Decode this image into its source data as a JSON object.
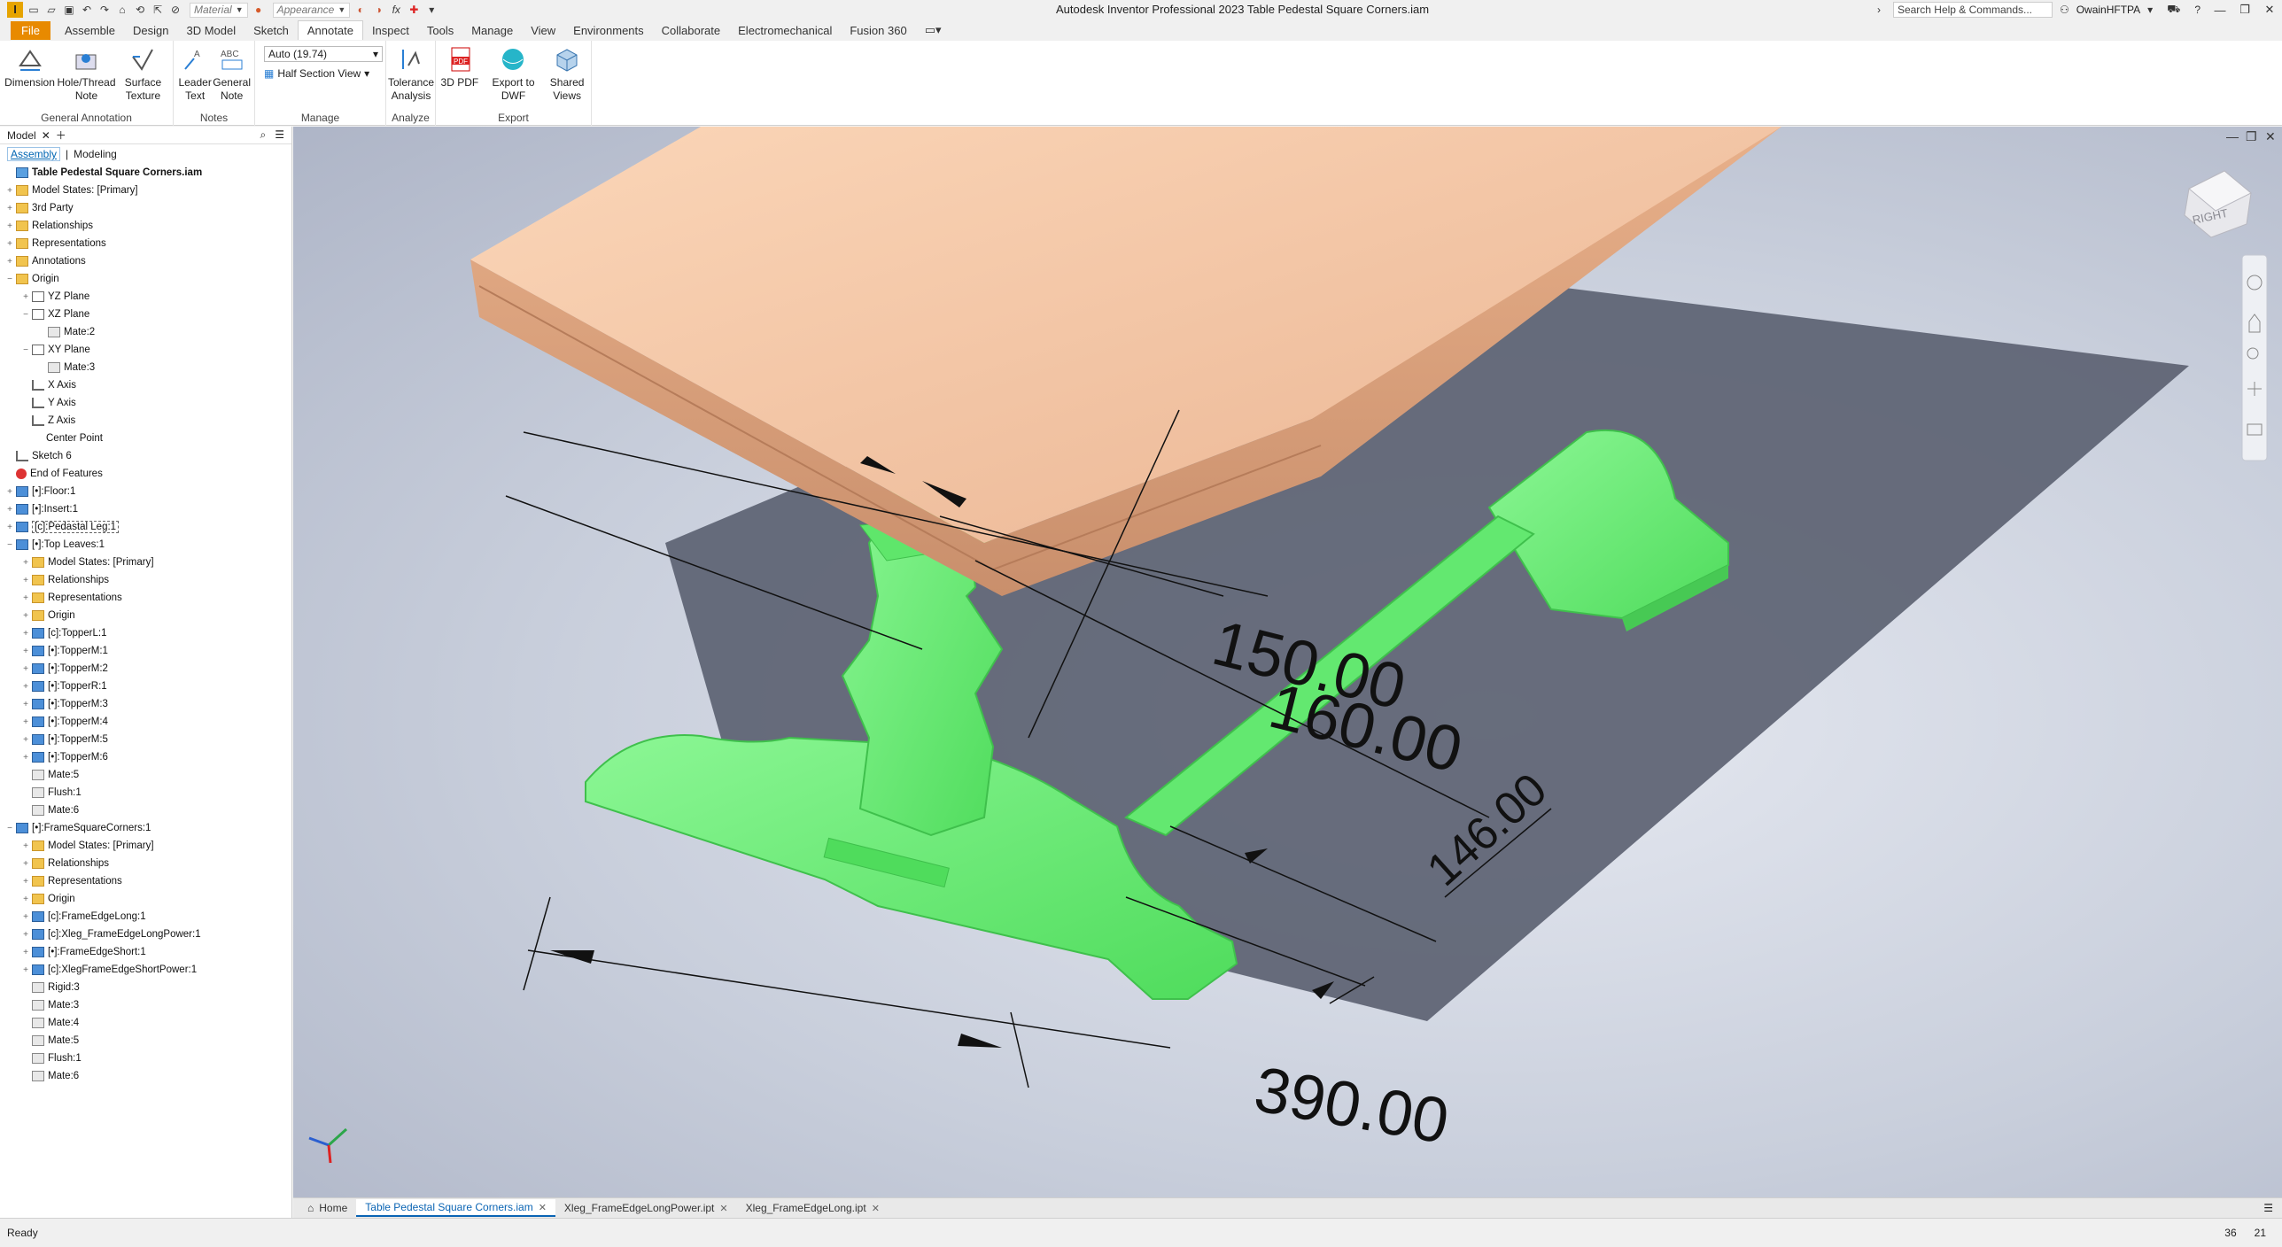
{
  "app": {
    "logo": "I",
    "window_title": "Autodesk Inventor Professional 2023   Table Pedestal Square Corners.iam",
    "material_placeholder": "Material",
    "appearance_placeholder": "Appearance",
    "search_placeholder": "Search Help & Commands...",
    "user": "OwainHFTPA"
  },
  "ribbon_tabs": [
    {
      "label": "File"
    },
    {
      "label": "Assemble"
    },
    {
      "label": "Design"
    },
    {
      "label": "3D Model"
    },
    {
      "label": "Sketch"
    },
    {
      "label": "Annotate"
    },
    {
      "label": "Inspect"
    },
    {
      "label": "Tools"
    },
    {
      "label": "Manage"
    },
    {
      "label": "View"
    },
    {
      "label": "Environments"
    },
    {
      "label": "Collaborate"
    },
    {
      "label": "Electromechanical"
    },
    {
      "label": "Fusion 360"
    }
  ],
  "ribbon": {
    "general_annotation": {
      "label": "General Annotation",
      "dimension": "Dimension",
      "hole_thread_note": "Hole/Thread Note",
      "surface_texture": "Surface Texture"
    },
    "notes": {
      "label": "Notes",
      "leader_text": "Leader Text",
      "general_note": "General Note"
    },
    "manage": {
      "label": "Manage",
      "auto_value": "Auto (19.74)",
      "section_view": "Half Section View"
    },
    "analyze": {
      "label": "Analyze",
      "tolerance_analysis": "Tolerance Analysis"
    },
    "export": {
      "label": "Export",
      "pdf_3d": "3D PDF",
      "export_dwf": "Export to DWF",
      "shared_views": "Shared Views"
    }
  },
  "browser": {
    "tab": "Model",
    "sub_assembly": "Assembly",
    "sub_modeling": "Modeling",
    "nodes": [
      {
        "label": "Table Pedestal Square Corners.iam",
        "indent": 0,
        "exp": "",
        "icon": "root",
        "bold": true
      },
      {
        "label": "Model States: [Primary]",
        "indent": 0,
        "exp": "+",
        "icon": "folder"
      },
      {
        "label": "3rd Party",
        "indent": 0,
        "exp": "+",
        "icon": "folder"
      },
      {
        "label": "Relationships",
        "indent": 0,
        "exp": "+",
        "icon": "folder"
      },
      {
        "label": "Representations",
        "indent": 0,
        "exp": "+",
        "icon": "folder"
      },
      {
        "label": "Annotations",
        "indent": 0,
        "exp": "+",
        "icon": "folder"
      },
      {
        "label": "Origin",
        "indent": 0,
        "exp": "−",
        "icon": "folder"
      },
      {
        "label": "YZ Plane",
        "indent": 1,
        "exp": "+",
        "icon": "plane"
      },
      {
        "label": "XZ Plane",
        "indent": 1,
        "exp": "−",
        "icon": "plane"
      },
      {
        "label": "Mate:2",
        "indent": 2,
        "exp": "",
        "icon": "mate"
      },
      {
        "label": "XY Plane",
        "indent": 1,
        "exp": "−",
        "icon": "plane"
      },
      {
        "label": "Mate:3",
        "indent": 2,
        "exp": "",
        "icon": "mate"
      },
      {
        "label": "X Axis",
        "indent": 1,
        "exp": "",
        "icon": "sketch"
      },
      {
        "label": "Y Axis",
        "indent": 1,
        "exp": "",
        "icon": "sketch"
      },
      {
        "label": "Z Axis",
        "indent": 1,
        "exp": "",
        "icon": "sketch"
      },
      {
        "label": "Center Point",
        "indent": 1,
        "exp": "",
        "icon": "point"
      },
      {
        "label": "Sketch 6",
        "indent": 0,
        "exp": "",
        "icon": "sketch"
      },
      {
        "label": "End of Features",
        "indent": 0,
        "exp": "",
        "icon": "eof"
      },
      {
        "label": "[•]:Floor:1",
        "indent": 0,
        "exp": "+",
        "icon": "part"
      },
      {
        "label": "[•]:Insert:1",
        "indent": 0,
        "exp": "+",
        "icon": "part"
      },
      {
        "label": "[c]:Pedastal Leg:1",
        "indent": 0,
        "exp": "+",
        "icon": "part",
        "selected": true
      },
      {
        "label": "[•]:Top Leaves:1",
        "indent": 0,
        "exp": "−",
        "icon": "part"
      },
      {
        "label": "Model States: [Primary]",
        "indent": 1,
        "exp": "+",
        "icon": "folder"
      },
      {
        "label": "Relationships",
        "indent": 1,
        "exp": "+",
        "icon": "folder"
      },
      {
        "label": "Representations",
        "indent": 1,
        "exp": "+",
        "icon": "folder"
      },
      {
        "label": "Origin",
        "indent": 1,
        "exp": "+",
        "icon": "folder"
      },
      {
        "label": "[c]:TopperL:1",
        "indent": 1,
        "exp": "+",
        "icon": "part"
      },
      {
        "label": "[•]:TopperM:1",
        "indent": 1,
        "exp": "+",
        "icon": "part"
      },
      {
        "label": "[•]:TopperM:2",
        "indent": 1,
        "exp": "+",
        "icon": "part"
      },
      {
        "label": "[•]:TopperR:1",
        "indent": 1,
        "exp": "+",
        "icon": "part"
      },
      {
        "label": "[•]:TopperM:3",
        "indent": 1,
        "exp": "+",
        "icon": "part"
      },
      {
        "label": "[•]:TopperM:4",
        "indent": 1,
        "exp": "+",
        "icon": "part"
      },
      {
        "label": "[•]:TopperM:5",
        "indent": 1,
        "exp": "+",
        "icon": "part"
      },
      {
        "label": "[•]:TopperM:6",
        "indent": 1,
        "exp": "+",
        "icon": "part"
      },
      {
        "label": "Mate:5",
        "indent": 1,
        "exp": "",
        "icon": "mate"
      },
      {
        "label": "Flush:1",
        "indent": 1,
        "exp": "",
        "icon": "mate"
      },
      {
        "label": "Mate:6",
        "indent": 1,
        "exp": "",
        "icon": "mate"
      },
      {
        "label": "[•]:FrameSquareCorners:1",
        "indent": 0,
        "exp": "−",
        "icon": "part"
      },
      {
        "label": "Model States: [Primary]",
        "indent": 1,
        "exp": "+",
        "icon": "folder"
      },
      {
        "label": "Relationships",
        "indent": 1,
        "exp": "+",
        "icon": "folder"
      },
      {
        "label": "Representations",
        "indent": 1,
        "exp": "+",
        "icon": "folder"
      },
      {
        "label": "Origin",
        "indent": 1,
        "exp": "+",
        "icon": "folder"
      },
      {
        "label": "[c]:FrameEdgeLong:1",
        "indent": 1,
        "exp": "+",
        "icon": "part"
      },
      {
        "label": "[c]:Xleg_FrameEdgeLongPower:1",
        "indent": 1,
        "exp": "+",
        "icon": "part"
      },
      {
        "label": "[•]:FrameEdgeShort:1",
        "indent": 1,
        "exp": "+",
        "icon": "part"
      },
      {
        "label": "[c]:XlegFrameEdgeShortPower:1",
        "indent": 1,
        "exp": "+",
        "icon": "part"
      },
      {
        "label": "Rigid:3",
        "indent": 1,
        "exp": "",
        "icon": "mate"
      },
      {
        "label": "Mate:3",
        "indent": 1,
        "exp": "",
        "icon": "mate"
      },
      {
        "label": "Mate:4",
        "indent": 1,
        "exp": "",
        "icon": "mate"
      },
      {
        "label": "Mate:5",
        "indent": 1,
        "exp": "",
        "icon": "mate"
      },
      {
        "label": "Flush:1",
        "indent": 1,
        "exp": "",
        "icon": "mate"
      },
      {
        "label": "Mate:6",
        "indent": 1,
        "exp": "",
        "icon": "mate"
      }
    ]
  },
  "viewport": {
    "dimensions": [
      "150.00",
      "160.00",
      "146.00",
      "390.00"
    ],
    "viewcube_label": "RIGHT",
    "colors": {
      "top": "#f3c5a3",
      "leg": "#6ef07a",
      "shadow": "#5d6374"
    }
  },
  "doc_tabs": [
    {
      "label": "Home",
      "closable": false
    },
    {
      "label": "Table Pedestal Square Corners.iam",
      "closable": true,
      "active": true
    },
    {
      "label": "Xleg_FrameEdgeLongPower.ipt",
      "closable": true
    },
    {
      "label": "Xleg_FrameEdgeLong.ipt",
      "closable": true
    }
  ],
  "status": {
    "text": "Ready",
    "count_a": "36",
    "count_b": "21"
  }
}
